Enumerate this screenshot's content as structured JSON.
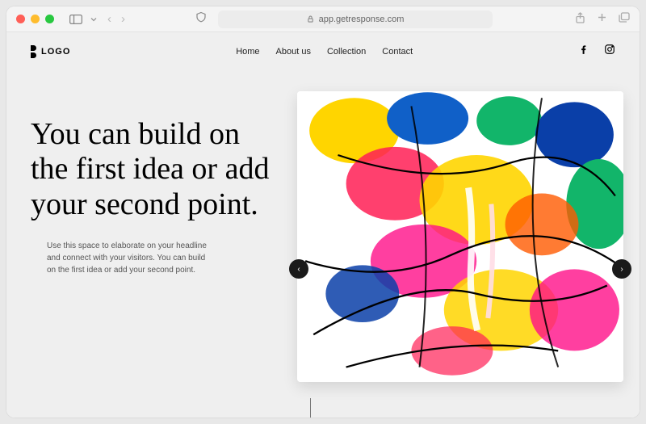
{
  "browser": {
    "address": "app.getresponse.com"
  },
  "logo": {
    "text": "LOGO"
  },
  "nav": {
    "items": [
      "Home",
      "About us",
      "Collection",
      "Contact"
    ]
  },
  "hero": {
    "headline": "You can build on the first idea or add your second point.",
    "subtext": "Use this space to elaborate on your headline and connect with your visitors. You can build on the first idea or add your second point."
  }
}
